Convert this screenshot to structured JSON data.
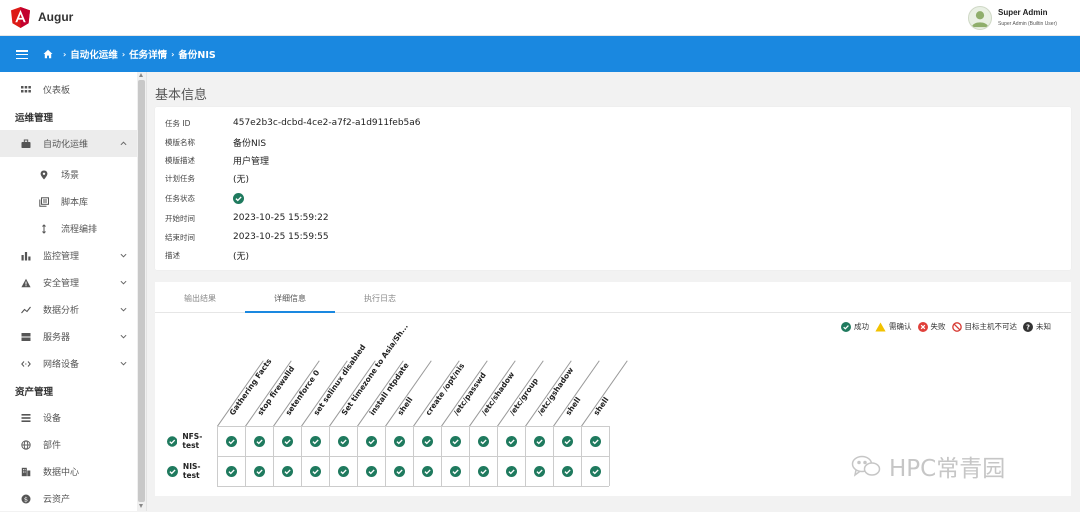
{
  "app": {
    "brand": "Augur"
  },
  "user": {
    "name": "Super Admin",
    "role": "Super Admin (Builtin User)"
  },
  "breadcrumb": [
    "自动化运维",
    "任务详情",
    "备份NIS"
  ],
  "sidebar": {
    "dashboard": "仪表板",
    "ops_header": "运维管理",
    "automation": "自动化运维",
    "scene": "场景",
    "scripts": "脚本库",
    "workflow": "流程编排",
    "monitoring": "监控管理",
    "security": "安全管理",
    "analytics": "数据分析",
    "servers": "服务器",
    "network": "网络设备",
    "assets_header": "资产管理",
    "devices": "设备",
    "parts": "部件",
    "datacenter": "数据中心",
    "cloud": "云资产"
  },
  "basic": {
    "title": "基本信息",
    "rows": [
      {
        "key": "任务 ID",
        "value": "457e2b3c-dcbd-4ce2-a7f2-a1d911feb5a6"
      },
      {
        "key": "模版名称",
        "value": "备份NIS"
      },
      {
        "key": "模版描述",
        "value": "用户管理"
      },
      {
        "key": "计划任务",
        "value": "(无)"
      },
      {
        "key": "任务状态",
        "value": ""
      },
      {
        "key": "开始时间",
        "value": "2023-10-25 15:59:22"
      },
      {
        "key": "结束时间",
        "value": "2023-10-25 15:59:55"
      },
      {
        "key": "描述",
        "value": "(无)"
      }
    ],
    "status": "success"
  },
  "tabs": [
    "输出结果",
    "详细信息",
    "执行日志"
  ],
  "active_tab": 1,
  "legend": [
    {
      "label": "成功",
      "icon": "success-icon"
    },
    {
      "label": "需确认",
      "icon": "warning-icon"
    },
    {
      "label": "失败",
      "icon": "fail-icon"
    },
    {
      "label": "目标主机不可达",
      "icon": "unreachable-icon"
    },
    {
      "label": "未知",
      "icon": "unknown-icon"
    }
  ],
  "matrix": {
    "columns": [
      "Gathering Facts",
      "stop firewalld",
      "setenforce 0",
      "set selinux disabled",
      "Set timezone to Asia/Sh...",
      "install ntpdate",
      "shell",
      "create /opt/nis",
      "/etc/passwd",
      "/etc/shadow",
      "/etc/group",
      "/etc/gshadow",
      "shell",
      "shell"
    ],
    "rows": [
      {
        "host": "NFS-test",
        "status": "success",
        "cells": [
          "success",
          "success",
          "success",
          "success",
          "success",
          "success",
          "success",
          "success",
          "success",
          "success",
          "success",
          "success",
          "success",
          "success"
        ]
      },
      {
        "host": "NIS-test",
        "status": "success",
        "cells": [
          "success",
          "success",
          "success",
          "success",
          "success",
          "success",
          "success",
          "success",
          "success",
          "success",
          "success",
          "success",
          "success",
          "success"
        ]
      }
    ]
  },
  "colors": {
    "primary": "#1a88e0",
    "success": "#1f7a5e",
    "warning": "#f2c200",
    "fail": "#e0403a"
  },
  "watermark": "HPC常青园"
}
